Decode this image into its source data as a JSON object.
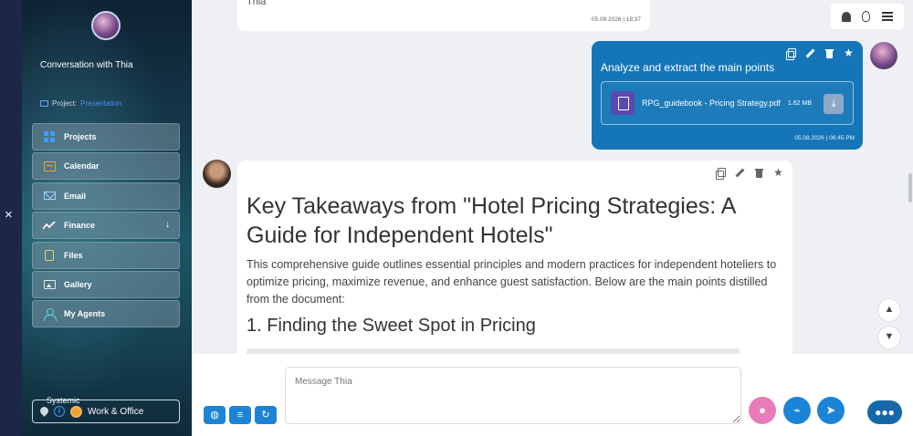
{
  "sidebar": {
    "close_icon": "×",
    "conversation_title": "Conversation with Thia",
    "project_label": "Project:",
    "project_value": "Presentation",
    "items": [
      {
        "label": "Projects",
        "icon": "grid-icon"
      },
      {
        "label": "Calendar",
        "icon": "calendar-icon"
      },
      {
        "label": "Email",
        "icon": "mail-icon"
      },
      {
        "label": "Finance",
        "icon": "chart-line-icon",
        "chevron": "↓"
      },
      {
        "label": "Files",
        "icon": "file-icon"
      },
      {
        "label": "Gallery",
        "icon": "image-icon"
      },
      {
        "label": "My Agents",
        "icon": "user-icon"
      }
    ],
    "footer_label": "Systemic",
    "footer_value": "Work & Office"
  },
  "chat": {
    "previous_snippet": "Thia",
    "previous_time": "05.08.2026 | 18:37",
    "user_message": "Analyze and extract the main points",
    "attachment_name": "RPG_guidebook - Pricing Strategy.pdf",
    "attachment_size": "1.62 MB",
    "user_time": "05.08.2026 | 06:45 PM",
    "bot_title": "Key Takeaways from \"Hotel Pricing Strategies: A Guide for Independent Hotels\"",
    "bot_paragraph": "This comprehensive guide outlines essential principles and modern practices for independent hoteliers to optimize pricing, maximize revenue, and enhance guest satisfaction. Below are the main points distilled from the document:",
    "bot_h2": "1. Finding the Sweet Spot in Pricing"
  },
  "composer": {
    "placeholder": "Message Thia"
  },
  "colors": {
    "accent": "#1476b8",
    "mic": "#e87bb9",
    "sidebar_top": "#0e2233"
  }
}
